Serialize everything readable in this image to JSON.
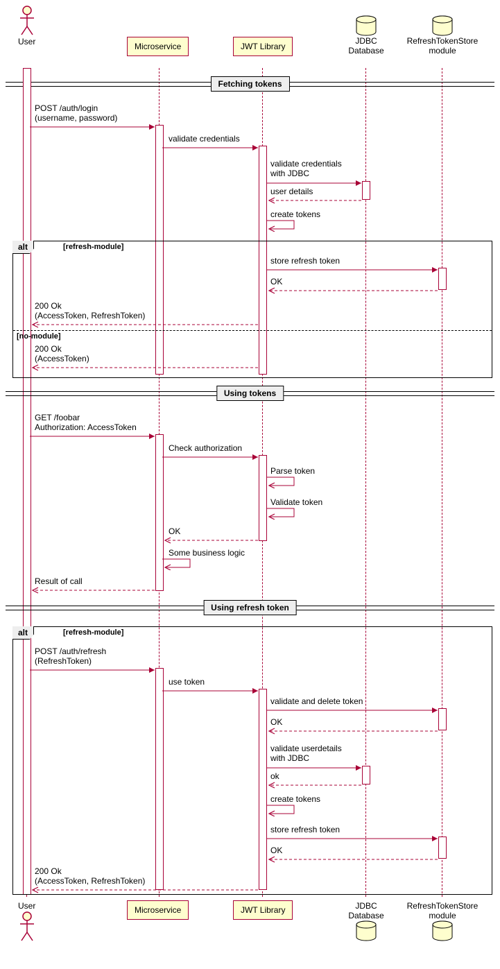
{
  "participants": {
    "user": "User",
    "microservice": "Microservice",
    "jwt": "JWT Library",
    "db": "JDBC\nDatabase",
    "store": "RefreshTokenStore\nmodule"
  },
  "dividers": {
    "d1": "Fetching tokens",
    "d2": "Using tokens",
    "d3": "Using refresh token"
  },
  "alt": {
    "tag": "alt",
    "g1": "[refresh-module]",
    "g2": "[no-module]",
    "g3": "[refresh-module]"
  },
  "messages": {
    "m1": "POST /auth/login\n(username, password)",
    "m2": "validate credentials",
    "m3": "validate credentials\nwith JDBC",
    "m4": "user details",
    "m5": "create tokens",
    "m6": "store refresh token",
    "m7": "OK",
    "m8": "200 Ok\n(AccessToken, RefreshToken)",
    "m9": "200 Ok\n(AccessToken)",
    "m10": "GET /foobar\nAuthorization: AccessToken",
    "m11": "Check authorization",
    "m12": "Parse token",
    "m13": "Validate token",
    "m14": "OK",
    "m15": "Some business logic",
    "m16": "Result of call",
    "m17": "POST /auth/refresh\n(RefreshToken)",
    "m18": "use token",
    "m19": "validate and delete token",
    "m20": "OK",
    "m21": "validate userdetails\nwith JDBC",
    "m22": "ok",
    "m23": "create tokens",
    "m24": "store refresh token",
    "m25": "OK",
    "m26": "200 Ok\n(AccessToken, RefreshToken)"
  },
  "chart_data": {
    "type": "sequence-diagram",
    "participants": [
      {
        "id": "user",
        "type": "actor",
        "name": "User"
      },
      {
        "id": "microservice",
        "type": "participant",
        "name": "Microservice"
      },
      {
        "id": "jwt",
        "type": "participant",
        "name": "JWT Library"
      },
      {
        "id": "db",
        "type": "database",
        "name": "JDBC Database"
      },
      {
        "id": "store",
        "type": "database",
        "name": "RefreshTokenStore module"
      }
    ],
    "sections": [
      {
        "divider": "Fetching tokens",
        "messages": [
          {
            "from": "user",
            "to": "microservice",
            "label": "POST /auth/login (username, password)",
            "kind": "sync"
          },
          {
            "from": "microservice",
            "to": "jwt",
            "label": "validate credentials",
            "kind": "sync"
          },
          {
            "from": "jwt",
            "to": "db",
            "label": "validate credentials with JDBC",
            "kind": "sync"
          },
          {
            "from": "db",
            "to": "jwt",
            "label": "user details",
            "kind": "return"
          },
          {
            "from": "jwt",
            "to": "jwt",
            "label": "create tokens",
            "kind": "self"
          }
        ],
        "combined_fragment": {
          "type": "alt",
          "operands": [
            {
              "guard": "refresh-module",
              "messages": [
                {
                  "from": "jwt",
                  "to": "store",
                  "label": "store refresh token",
                  "kind": "sync"
                },
                {
                  "from": "store",
                  "to": "jwt",
                  "label": "OK",
                  "kind": "return"
                },
                {
                  "from": "jwt",
                  "to": "user",
                  "label": "200 Ok (AccessToken, RefreshToken)",
                  "kind": "return"
                }
              ]
            },
            {
              "guard": "no-module",
              "messages": [
                {
                  "from": "jwt",
                  "to": "user",
                  "label": "200 Ok (AccessToken)",
                  "kind": "return"
                }
              ]
            }
          ]
        }
      },
      {
        "divider": "Using tokens",
        "messages": [
          {
            "from": "user",
            "to": "microservice",
            "label": "GET /foobar Authorization: AccessToken",
            "kind": "sync"
          },
          {
            "from": "microservice",
            "to": "jwt",
            "label": "Check authorization",
            "kind": "sync"
          },
          {
            "from": "jwt",
            "to": "jwt",
            "label": "Parse token",
            "kind": "self"
          },
          {
            "from": "jwt",
            "to": "jwt",
            "label": "Validate token",
            "kind": "self"
          },
          {
            "from": "jwt",
            "to": "microservice",
            "label": "OK",
            "kind": "return"
          },
          {
            "from": "microservice",
            "to": "microservice",
            "label": "Some business logic",
            "kind": "self"
          },
          {
            "from": "microservice",
            "to": "user",
            "label": "Result of call",
            "kind": "return"
          }
        ]
      },
      {
        "divider": "Using refresh token",
        "combined_fragment": {
          "type": "alt",
          "operands": [
            {
              "guard": "refresh-module",
              "messages": [
                {
                  "from": "user",
                  "to": "microservice",
                  "label": "POST /auth/refresh (RefreshToken)",
                  "kind": "sync"
                },
                {
                  "from": "microservice",
                  "to": "jwt",
                  "label": "use token",
                  "kind": "sync"
                },
                {
                  "from": "jwt",
                  "to": "store",
                  "label": "validate and delete token",
                  "kind": "sync"
                },
                {
                  "from": "store",
                  "to": "jwt",
                  "label": "OK",
                  "kind": "return"
                },
                {
                  "from": "jwt",
                  "to": "db",
                  "label": "validate userdetails with JDBC",
                  "kind": "sync"
                },
                {
                  "from": "db",
                  "to": "jwt",
                  "label": "ok",
                  "kind": "return"
                },
                {
                  "from": "jwt",
                  "to": "jwt",
                  "label": "create tokens",
                  "kind": "self"
                },
                {
                  "from": "jwt",
                  "to": "store",
                  "label": "store refresh token",
                  "kind": "sync"
                },
                {
                  "from": "store",
                  "to": "jwt",
                  "label": "OK",
                  "kind": "return"
                },
                {
                  "from": "jwt",
                  "to": "user",
                  "label": "200 Ok (AccessToken, RefreshToken)",
                  "kind": "return"
                }
              ]
            }
          ]
        }
      }
    ]
  }
}
